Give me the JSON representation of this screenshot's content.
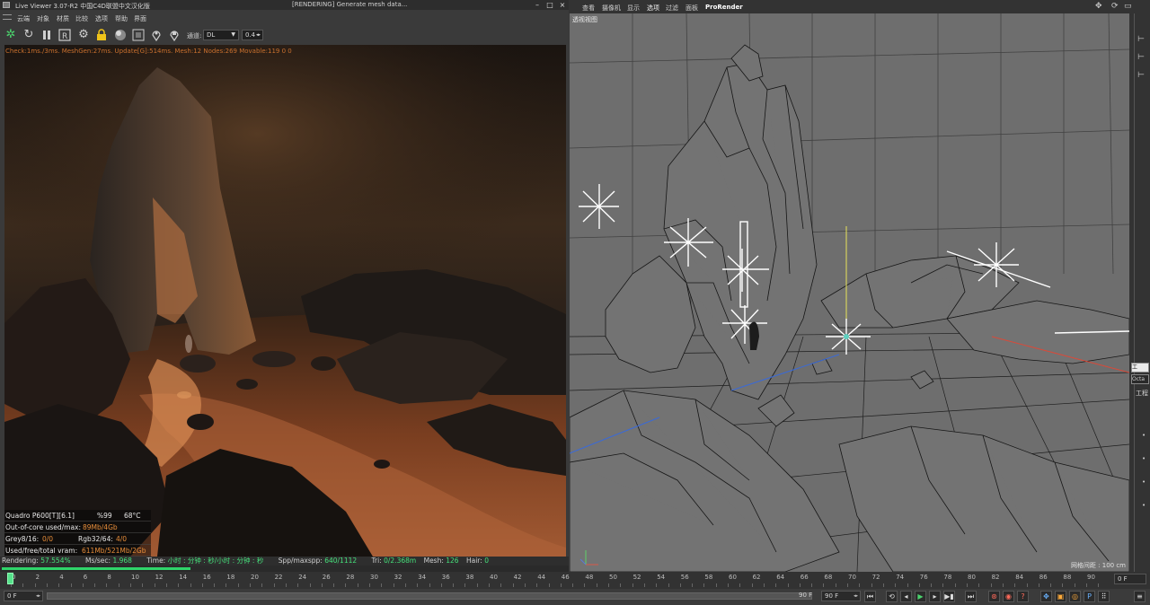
{
  "live_viewer": {
    "title": "Live Viewer 3.07-R2 中国C4D联盟中文汉化版",
    "status": "[RENDERING] Generate mesh data...",
    "menu": [
      "云端",
      "对象",
      "材质",
      "比较",
      "选项",
      "帮助",
      "界面"
    ],
    "toolbar": {
      "channel_label": "通道:",
      "channel_value": "DL",
      "value_field": "0.4"
    },
    "icons": [
      "octane-logo-icon",
      "refresh-icon",
      "pause-icon",
      "restart-icon",
      "settings-gear-icon",
      "lock-icon",
      "sphere-icon",
      "clay-icon",
      "pick-focus-icon",
      "pick-material-icon",
      "region-render-icon"
    ],
    "stats_line": "Check:1ms./3ms. MeshGen:27ms. Update[G]:514ms. Mesh:12 Nodes:269 Movable:119  0 0",
    "gpu": {
      "name": "Quadro P600[T][6.1]",
      "usage": "%99",
      "temp": "68°C",
      "out_of_core_label": "Out-of-core used/max:",
      "out_of_core_value": "89Mb/4Gb",
      "grey_label": "Grey8/16:",
      "grey_value": "0/0",
      "rgb_label": "Rgb32/64:",
      "rgb_value": "4/0",
      "vram_label": "Used/free/total vram:",
      "vram_value": "611Mb/521Mb/2Gb"
    },
    "status_bar": {
      "rendering_label": "Rendering:",
      "rendering_value": "57.554%",
      "ms_label": "Ms/sec:",
      "ms_value": "1.968",
      "time_label": "Time:",
      "time_value": "小时 : 分钟 : 秒/小时 : 分钟 : 秒",
      "spp_label": "Spp/maxspp:",
      "spp_value": "640/1112",
      "tri_label": "Tri:",
      "tri_value": "0/2.368m",
      "mesh_label": "Mesh:",
      "mesh_value": "126",
      "hair_label": "Hair:",
      "hair_value": "0"
    },
    "progress": 0.57554
  },
  "viewport": {
    "menu": [
      "查看",
      "摄像机",
      "显示",
      "选项",
      "过滤",
      "面板",
      "ProRender"
    ],
    "label": "透视视图",
    "grid_spacing": "网格间距 : 100 cm"
  },
  "side_panel": {
    "items": [
      "工",
      "Octa",
      "工程"
    ]
  },
  "timeline": {
    "ticks": [
      "0",
      "2",
      "4",
      "6",
      "8",
      "10",
      "12",
      "14",
      "16",
      "18",
      "20",
      "22",
      "24",
      "26",
      "28",
      "30",
      "32",
      "34",
      "36",
      "38",
      "40",
      "42",
      "44",
      "46",
      "48",
      "50",
      "52",
      "54",
      "56",
      "58",
      "60",
      "62",
      "64",
      "66",
      "68",
      "70",
      "72",
      "74",
      "76",
      "78",
      "80",
      "82",
      "84",
      "86",
      "88",
      "90"
    ],
    "current_frame": "0 F",
    "start_frame": "0 F",
    "end_frame": "90 F",
    "end_frame_2": "90 F",
    "right_field": "0 F"
  },
  "colors": {
    "progress_green": "#2fd56a",
    "stats_orange": "#c9702e",
    "viewport_grey": "#6e6e6e"
  }
}
